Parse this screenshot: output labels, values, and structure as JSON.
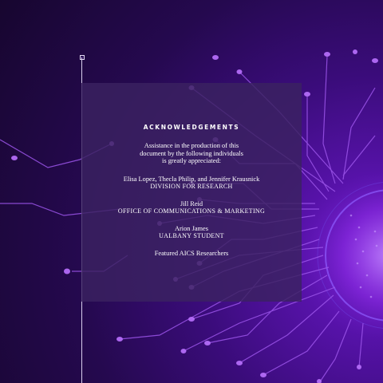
{
  "document": {
    "heading": "ACKNOWLEDGEMENTS",
    "intro_lines": [
      "Assistance in the production of this",
      "document by the following individuals",
      "is greatly appreciated:"
    ],
    "credits": [
      {
        "names": "Elisa Lopez, Thecla Philip, and Jennifer Krausnick",
        "org": "DIVISION FOR RESEARCH"
      },
      {
        "names": "Jill Reid",
        "org": "OFFICE OF COMMUNICATIONS & MARKETING"
      },
      {
        "names": "Arion James",
        "org": "UALBANY STUDENT"
      }
    ],
    "featured": "Featured AICS Researchers"
  },
  "colors": {
    "background": "#25094f",
    "accent": "#a35cf0",
    "panel": "#3a2260",
    "text": "#ffffff"
  }
}
